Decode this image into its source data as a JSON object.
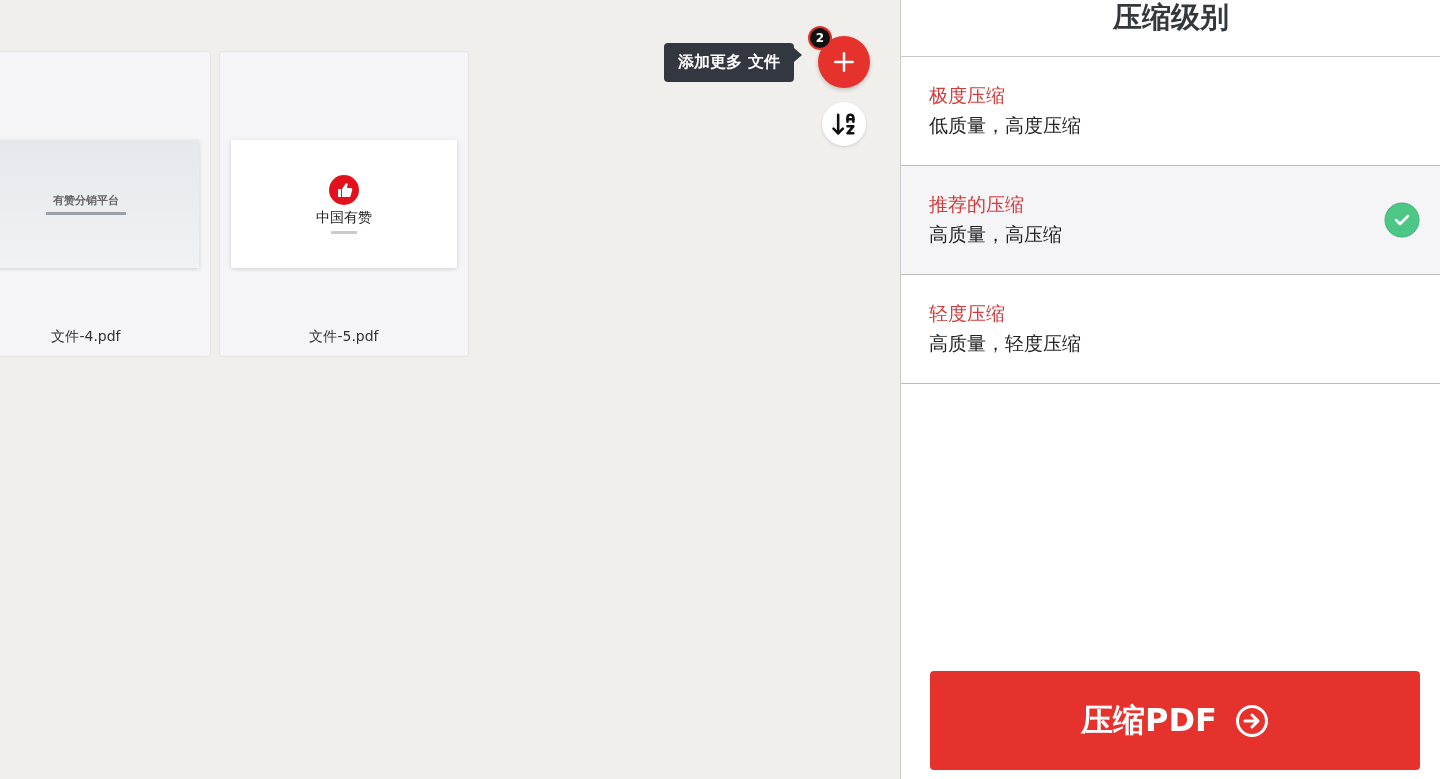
{
  "files": [
    {
      "name": "文件-4.pdf",
      "preview": {
        "kind": "slide",
        "title": "有赞分销平台"
      }
    },
    {
      "name": "文件-5.pdf",
      "preview": {
        "kind": "logo",
        "title": "中国有赞"
      }
    }
  ],
  "add_files": {
    "tooltip": "添加更多 文件",
    "badge": "2"
  },
  "panel": {
    "title": "压缩级别",
    "options": [
      {
        "name": "极度压缩",
        "description": "低质量，高度压缩",
        "selected": false
      },
      {
        "name": "推荐的压缩",
        "description": "高质量，高压缩",
        "selected": true
      },
      {
        "name": "轻度压缩",
        "description": "高质量，轻度压缩",
        "selected": false
      }
    ]
  },
  "action_button": {
    "label": "压缩PDF"
  }
}
